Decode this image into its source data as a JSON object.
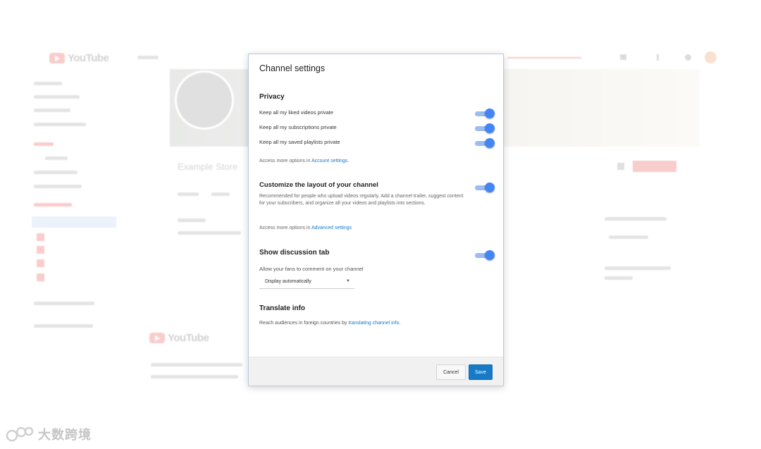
{
  "background": {
    "logo_text": "YouTube",
    "channel_name": "Example Store",
    "footer_logo_text": "YouTube"
  },
  "dialog": {
    "title": "Channel settings",
    "privacy": {
      "heading": "Privacy",
      "rows": [
        {
          "label": "Keep all my liked videos private",
          "on": true
        },
        {
          "label": "Keep all my subscriptions private",
          "on": true
        },
        {
          "label": "Keep all my saved playlists private",
          "on": true
        }
      ],
      "more_prefix": "Access more options in ",
      "more_link": "Account settings",
      "more_suffix": "."
    },
    "layout": {
      "heading": "Customize the layout of your channel",
      "on": true,
      "description": "Recommended for people who upload videos regularly. Add a channel trailer, suggest content for your subscribers, and organize all your videos and playlists into sections.",
      "more_prefix": "Access more options in ",
      "more_link": "Advanced settings"
    },
    "discussion": {
      "heading": "Show discussion tab",
      "on": true,
      "label": "Allow your fans to comment on your channel",
      "select_value": "Display automatically"
    },
    "translate": {
      "heading": "Translate info",
      "text_prefix": "Reach audiences in foreign countries by ",
      "link": "translating channel info",
      "text_suffix": "."
    },
    "footer": {
      "cancel_label": "Cancel",
      "save_label": "Save"
    }
  },
  "watermark": {
    "text": "大数跨境"
  },
  "colors": {
    "accent": "#167ac6",
    "toggle_on": "#4285f4",
    "brand_red": "#e62117"
  }
}
